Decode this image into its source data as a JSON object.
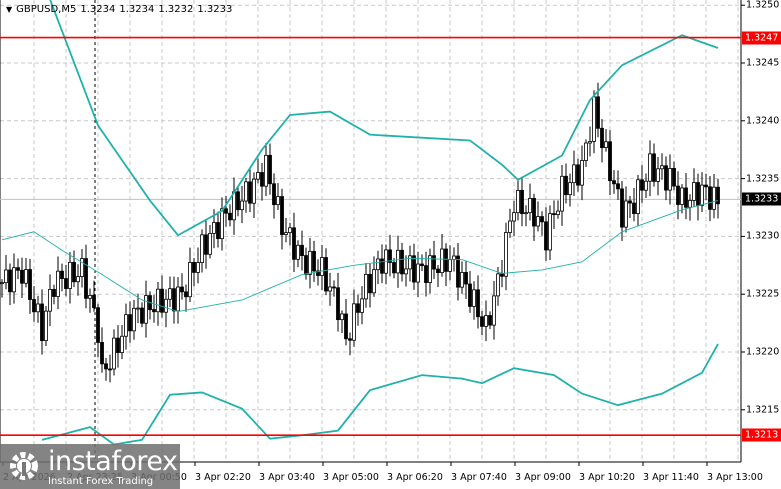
{
  "header": {
    "symbol": "GBPUSD,M5",
    "open": "1.3234",
    "high": "1.3234",
    "low": "1.3232",
    "close": "1.3233"
  },
  "price_axis": {
    "labels": [
      "1.3250",
      "1.3245",
      "1.3240",
      "1.3235",
      "1.3230",
      "1.3225",
      "1.3220",
      "1.3215"
    ],
    "min": 1.32095,
    "max": 1.32505
  },
  "levels": [
    {
      "label": "1.3247",
      "price": 1.32472,
      "color": "#ff0000"
    },
    {
      "label": "1.3213",
      "price": 1.32128,
      "color": "#ff0000"
    }
  ],
  "current_price": {
    "label": "1.3233",
    "price": 1.32332
  },
  "time_axis": {
    "labels": [
      "2 Apr 2026",
      "2 Apr 23:25",
      "3 Apr 00:50",
      "3 Apr 02:20",
      "3 Apr 03:40",
      "3 Apr 05:00",
      "3 Apr 06:20",
      "3 Apr 07:40",
      "3 Apr 09:00",
      "3 Apr 10:20",
      "3 Apr 11:40",
      "3 Apr 13:00"
    ]
  },
  "bollinger": {
    "color": "#20b2aa",
    "upper": [
      [
        12,
        1.32505
      ],
      [
        24,
        1.32396
      ],
      [
        37,
        1.32331
      ],
      [
        44,
        1.32301
      ],
      [
        55,
        1.32322
      ],
      [
        65,
        1.32375
      ],
      [
        72,
        1.32405
      ],
      [
        82,
        1.32408
      ],
      [
        92,
        1.32388
      ],
      [
        117,
        1.32383
      ],
      [
        125,
        1.32362
      ],
      [
        129,
        1.32349
      ],
      [
        140,
        1.3237
      ],
      [
        147,
        1.32418
      ],
      [
        155,
        1.32448
      ],
      [
        170,
        1.32474
      ],
      [
        179,
        1.32463
      ]
    ],
    "middle": [
      [
        0,
        1.32297
      ],
      [
        8,
        1.32304
      ],
      [
        15,
        1.32288
      ],
      [
        25,
        1.32267
      ],
      [
        35,
        1.32245
      ],
      [
        44,
        1.32235
      ],
      [
        60,
        1.32245
      ],
      [
        75,
        1.32267
      ],
      [
        88,
        1.32275
      ],
      [
        102,
        1.32281
      ],
      [
        115,
        1.3228
      ],
      [
        125,
        1.32268
      ],
      [
        135,
        1.32271
      ],
      [
        145,
        1.32278
      ],
      [
        155,
        1.32304
      ],
      [
        170,
        1.32323
      ],
      [
        179,
        1.32331
      ]
    ],
    "lower": [
      [
        10,
        1.32124
      ],
      [
        22,
        1.32135
      ],
      [
        28,
        1.3212
      ],
      [
        35,
        1.32124
      ],
      [
        42,
        1.32163
      ],
      [
        50,
        1.32165
      ],
      [
        60,
        1.32151
      ],
      [
        67,
        1.32125
      ],
      [
        75,
        1.32128
      ],
      [
        84,
        1.32132
      ],
      [
        92,
        1.32167
      ],
      [
        105,
        1.3218
      ],
      [
        115,
        1.32177
      ],
      [
        120,
        1.32173
      ],
      [
        128,
        1.32186
      ],
      [
        138,
        1.3218
      ],
      [
        145,
        1.32164
      ],
      [
        154,
        1.32154
      ],
      [
        165,
        1.32164
      ],
      [
        175,
        1.32182
      ],
      [
        179,
        1.32207
      ]
    ]
  },
  "closes": [
    [
      0,
      1.3226
    ],
    [
      5,
      1.3227
    ],
    [
      10,
      1.3222
    ],
    [
      13,
      1.3226
    ],
    [
      20,
      1.3227
    ],
    [
      24,
      1.3222
    ],
    [
      25,
      1.3218
    ],
    [
      28,
      1.322
    ],
    [
      32,
      1.3223
    ],
    [
      37,
      1.3224
    ],
    [
      45,
      1.3225
    ],
    [
      50,
      1.3229
    ],
    [
      56,
      1.3232
    ],
    [
      62,
      1.3234
    ],
    [
      66,
      1.3236
    ],
    [
      70,
      1.3231
    ],
    [
      75,
      1.3228
    ],
    [
      80,
      1.3227
    ],
    [
      84,
      1.3224
    ],
    [
      86,
      1.3221
    ],
    [
      90,
      1.3225
    ],
    [
      95,
      1.3228
    ],
    [
      105,
      1.3227
    ],
    [
      112,
      1.3228
    ],
    [
      117,
      1.3225
    ],
    [
      121,
      1.3222
    ],
    [
      124,
      1.3226
    ],
    [
      128,
      1.3233
    ],
    [
      133,
      1.3232
    ],
    [
      136,
      1.323
    ],
    [
      140,
      1.3234
    ],
    [
      145,
      1.3236
    ],
    [
      148,
      1.3241
    ],
    [
      151,
      1.3237
    ],
    [
      155,
      1.3232
    ],
    [
      158,
      1.3233
    ],
    [
      162,
      1.3236
    ],
    [
      167,
      1.3235
    ],
    [
      170,
      1.3233
    ],
    [
      175,
      1.3234
    ],
    [
      179,
      1.3233
    ]
  ],
  "logo": {
    "name": "instaforex",
    "tagline": "Instant Forex Trading"
  }
}
